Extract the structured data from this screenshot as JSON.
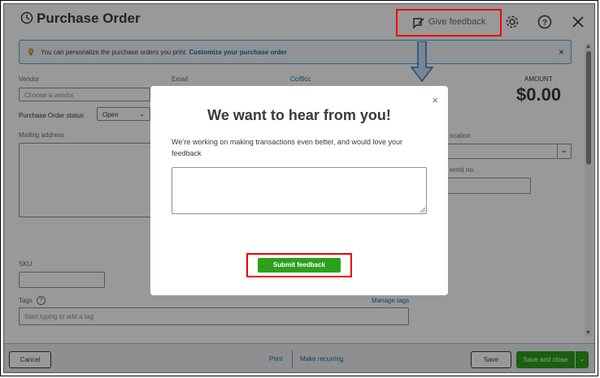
{
  "header": {
    "title": "Purchase Order",
    "feedback_label": "Give feedback"
  },
  "banner": {
    "text": "You can personalize the purchase orders you print.",
    "link": "Customize your purchase order",
    "close": "×"
  },
  "form": {
    "vendor_label": "Vendor",
    "vendor_placeholder": "Choose a vendor",
    "email_label": "Email",
    "ccbcc": "Cc/Bcc",
    "status_label": "Purchase Order status",
    "status_value": "Open",
    "mailing_label": "Mailing address",
    "amount_label": "AMOUNT",
    "amount_value": "$0.00",
    "location_label": "ocation",
    "permit_label": "ermit no.",
    "sku_label": "SKU",
    "tags_label": "Tags",
    "tags_placeholder": "Start typing to add a tag",
    "manage_tags": "Manage tags"
  },
  "modal": {
    "close": "×",
    "title": "We want to hear from you!",
    "description": "We’re working on making transactions even better, and would love your feedback",
    "submit": "Submit feedback"
  },
  "footer": {
    "cancel": "Cancel",
    "print": "Print",
    "make_recurring": "Make recurring",
    "save": "Save",
    "save_and_close": "Save and close"
  },
  "colors": {
    "accent_green": "#2ca01c",
    "highlight_red": "#ee0000",
    "link_blue": "#0d6ea8"
  }
}
